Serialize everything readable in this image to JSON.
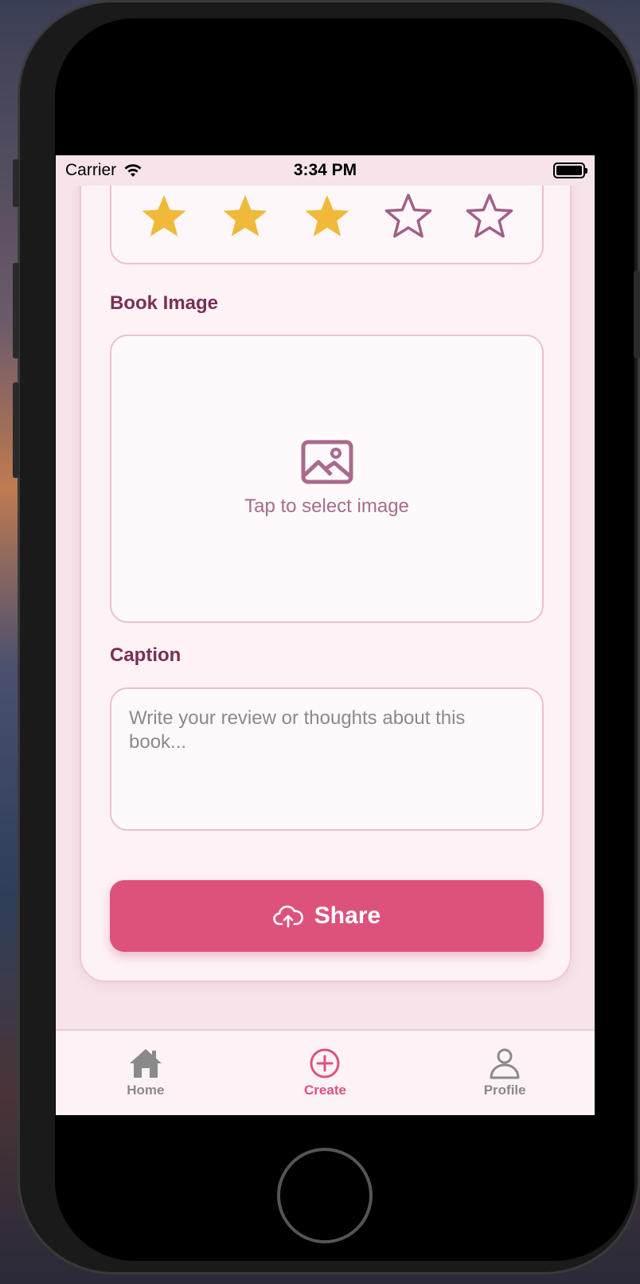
{
  "status_bar": {
    "carrier": "Carrier",
    "time": "3:34 PM"
  },
  "rating": {
    "value": 3,
    "max": 5,
    "filled_color": "#f0b93a",
    "empty_color": "#a0608a"
  },
  "book_image": {
    "label": "Book Image",
    "hint": "Tap to select image"
  },
  "caption": {
    "label": "Caption",
    "placeholder": "Write your review or thoughts about this book..."
  },
  "share_button": {
    "label": "Share",
    "color": "#dd527b"
  },
  "tabs": [
    {
      "label": "Home",
      "icon": "home-icon",
      "active": false
    },
    {
      "label": "Create",
      "icon": "plus-circle-icon",
      "active": true
    },
    {
      "label": "Profile",
      "icon": "person-icon",
      "active": false
    }
  ],
  "colors": {
    "accent": "#dd527b",
    "label": "#7a2f55",
    "background": "#f6e4ea"
  }
}
